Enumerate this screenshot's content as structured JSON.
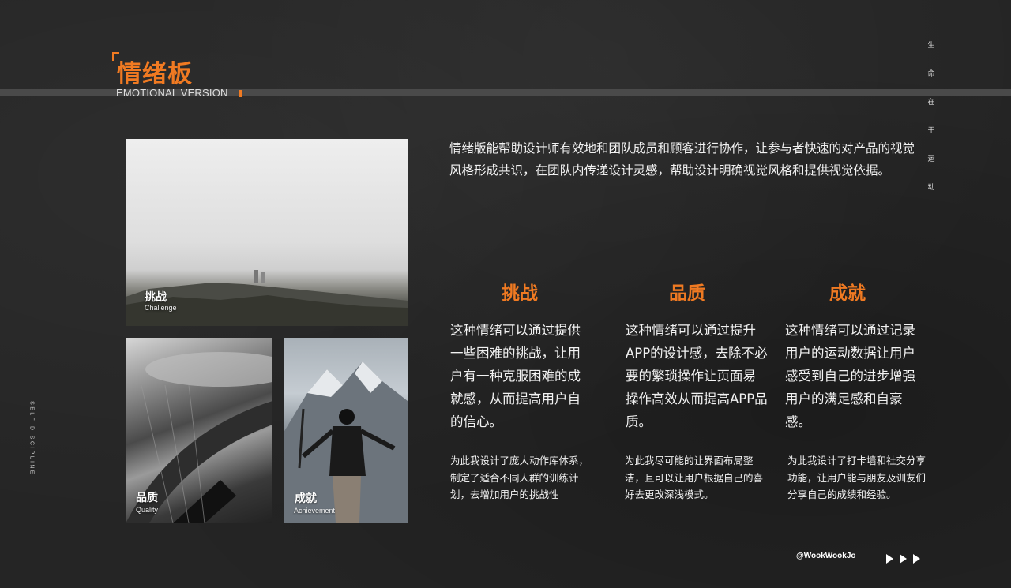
{
  "header": {
    "title": "情绪板",
    "subtitle": "EMOTIONAL VERSION"
  },
  "vertical_text": [
    "生",
    "命",
    "在",
    "于",
    "运",
    "动"
  ],
  "side_label": "SELF-DISCIPLINE",
  "intro": "情绪版能帮助设计师有效地和团队成员和顾客进行协作，让参与者快速的对产品的视觉风格形成共识，在团队内传递设计灵感，帮助设计明确视觉风格和提供视觉依据。",
  "photos": [
    {
      "caption_cn": "挑战",
      "caption_en": "Challenge"
    },
    {
      "caption_cn": "品质",
      "caption_en": "Quality"
    },
    {
      "caption_cn": "成就",
      "caption_en": "Achievement"
    }
  ],
  "columns": [
    {
      "title": "挑战",
      "body": "这种情绪可以通过提供一些困难的挑战，让用户有一种克服困难的成就感，从而提高用户自的信心。",
      "note": "为此我设计了庞大动作库体系，制定了适合不同人群的训练计划，去增加用户的挑战性"
    },
    {
      "title": "品质",
      "body": "这种情绪可以通过提升APP的设计感，去除不必要的繁琐操作让页面易操作高效从而提高APP品质。",
      "note": "为此我尽可能的让界面布局整洁，且可以让用户根据自己的喜好去更改深浅模式。"
    },
    {
      "title": "成就",
      "body": "这种情绪可以通过记录用户的运动数据让用户感受到自己的进步增强用户的满足感和自豪感。",
      "note": "为此我设计了打卡墙和社交分享功能，让用户能与朋友及训友们分享自己的成绩和经验。"
    }
  ],
  "footer": {
    "handle": "@WookWookJo",
    "arrow_icons": [
      "play-arrow-icon",
      "play-arrow-icon",
      "play-arrow-icon"
    ]
  },
  "colors": {
    "accent": "#f07a22",
    "background": "#252525",
    "band": "#4a4a4a"
  }
}
